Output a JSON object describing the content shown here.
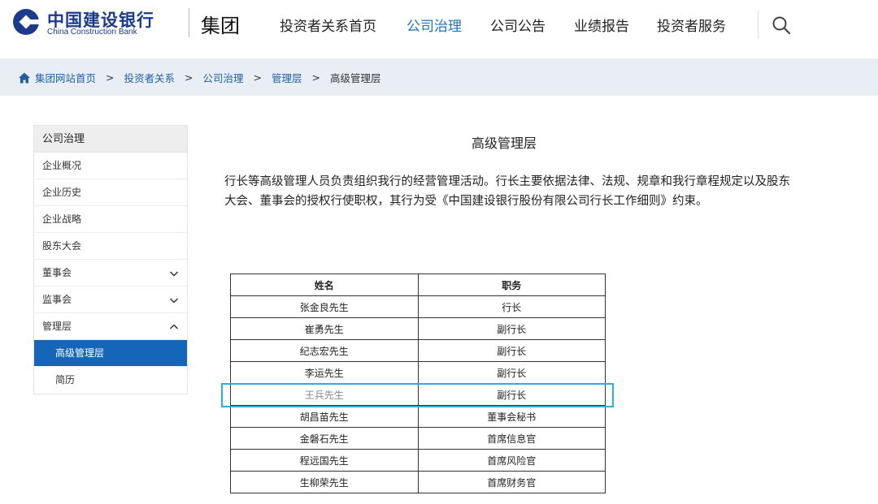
{
  "header": {
    "logo_cn": "中国建设银行",
    "logo_en": "China Construction Bank",
    "group_title": "集团",
    "nav": [
      {
        "label": "投资者关系首页",
        "active": false
      },
      {
        "label": "公司治理",
        "active": true
      },
      {
        "label": "公司公告",
        "active": false
      },
      {
        "label": "业绩报告",
        "active": false
      },
      {
        "label": "投资者服务",
        "active": false
      }
    ],
    "search_icon": "search-icon"
  },
  "breadcrumb": {
    "items": [
      "集团网站首页",
      "投资者关系",
      "公司治理",
      "管理层"
    ],
    "current": "高级管理层",
    "separator": ">"
  },
  "sidebar": {
    "title": "公司治理",
    "items": [
      {
        "label": "企业概况"
      },
      {
        "label": "企业历史"
      },
      {
        "label": "企业战略"
      },
      {
        "label": "股东大会"
      },
      {
        "label": "董事会",
        "chevron": "chevron-down-icon"
      },
      {
        "label": "监事会",
        "chevron": "chevron-down-icon"
      },
      {
        "label": "管理层",
        "chevron": "chevron-up-icon"
      }
    ],
    "sub_items": [
      {
        "label": "高级管理层",
        "active": true
      },
      {
        "label": "简历",
        "active": false
      }
    ]
  },
  "main": {
    "title": "高级管理层",
    "intro": "行长等高级管理人员负责组织我行的经营管理活动。行长主要依据法律、法规、规章和我行章程规定以及股东大会、董事会的授权行使职权，其行为受《中国建设银行股份有限公司行长工作细则》约束。",
    "table": {
      "headers": [
        "姓名",
        "职务"
      ],
      "rows": [
        [
          "张金良先生",
          "行长"
        ],
        [
          "崔勇先生",
          "副行长"
        ],
        [
          "纪志宏先生",
          "副行长"
        ],
        [
          "李运先生",
          "副行长"
        ],
        [
          "王兵先生",
          "副行长"
        ],
        [
          "胡昌苗先生",
          "董事会秘书"
        ],
        [
          "金磐石先生",
          "首席信息官"
        ],
        [
          "程远国先生",
          "首席风险官"
        ],
        [
          "生柳荣先生",
          "首席财务官"
        ]
      ]
    }
  },
  "colors": {
    "brand": "#1b3a8c",
    "link": "#1e5fa8",
    "active_nav": "#1e73be",
    "sidebar_active": "#1565b8",
    "breadcrumb_bg": "#e9eef5",
    "highlight": "#29b0d9"
  }
}
